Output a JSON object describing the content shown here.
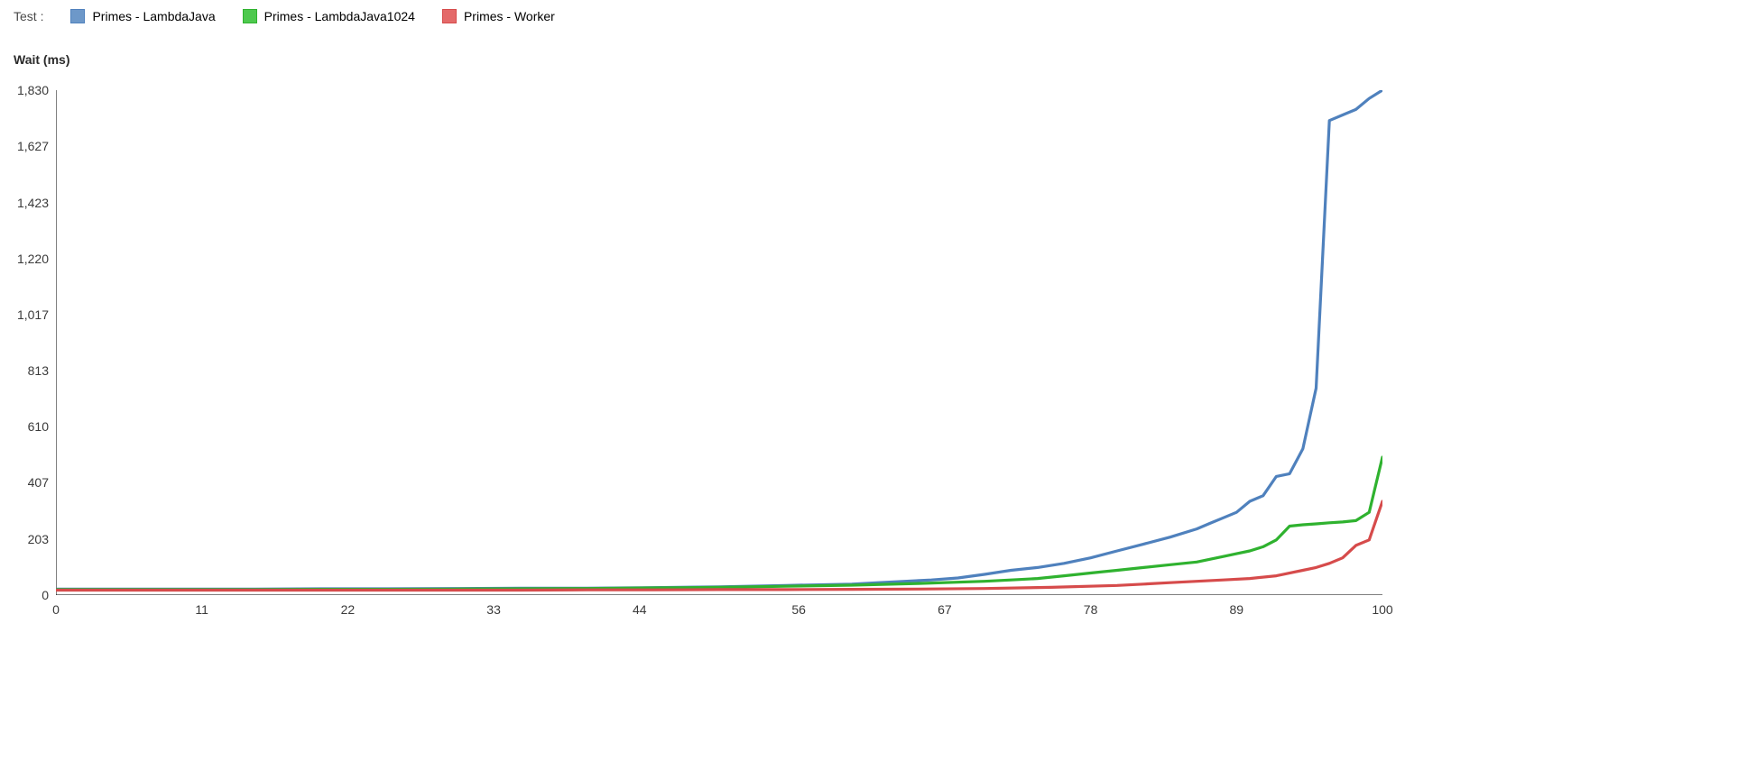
{
  "legend": {
    "label": "Test :",
    "items": [
      {
        "name": "Primes - LambdaJava",
        "color": "#4f81bd",
        "fill": "#6d98c9"
      },
      {
        "name": "Primes - LambdaJava1024",
        "color": "#2fb22f",
        "fill": "#4ec94e"
      },
      {
        "name": "Primes - Worker",
        "color": "#d64b4b",
        "fill": "#e46a6a"
      }
    ]
  },
  "y_title": "Wait (ms)",
  "chart_data": {
    "type": "line",
    "xlabel": "",
    "ylabel": "Wait (ms)",
    "xlim": [
      0,
      100
    ],
    "ylim": [
      0,
      1830
    ],
    "x_ticks": [
      0,
      11,
      22,
      33,
      44,
      56,
      67,
      78,
      89,
      100
    ],
    "y_ticks": [
      0,
      203,
      407,
      610,
      813,
      1017,
      1220,
      1423,
      1627,
      1830
    ],
    "series": [
      {
        "name": "Primes - LambdaJava",
        "color": "#4f81bd",
        "x": [
          0,
          5,
          10,
          15,
          20,
          25,
          30,
          35,
          40,
          45,
          50,
          55,
          60,
          62,
          64,
          66,
          68,
          70,
          72,
          74,
          76,
          78,
          80,
          82,
          84,
          86,
          87,
          88,
          89,
          90,
          91,
          92,
          93,
          94,
          95,
          96,
          97,
          98,
          99,
          100
        ],
        "values": [
          22,
          22,
          22,
          22,
          23,
          23,
          24,
          25,
          25,
          27,
          30,
          35,
          40,
          45,
          50,
          55,
          62,
          75,
          90,
          100,
          115,
          135,
          160,
          185,
          210,
          240,
          260,
          280,
          300,
          340,
          360,
          430,
          440,
          530,
          750,
          1720,
          1740,
          1760,
          1800,
          1830
        ]
      },
      {
        "name": "Primes - LambdaJava1024",
        "color": "#2fb22f",
        "x": [
          0,
          5,
          10,
          15,
          20,
          25,
          30,
          35,
          40,
          45,
          50,
          55,
          60,
          65,
          70,
          72,
          74,
          76,
          78,
          80,
          82,
          84,
          86,
          88,
          89,
          90,
          91,
          92,
          93,
          94,
          95,
          96,
          97,
          98,
          99,
          100
        ],
        "values": [
          20,
          20,
          20,
          20,
          21,
          21,
          22,
          23,
          24,
          26,
          28,
          32,
          36,
          42,
          50,
          55,
          60,
          70,
          80,
          90,
          100,
          110,
          120,
          140,
          150,
          160,
          175,
          200,
          250,
          255,
          258,
          262,
          265,
          270,
          300,
          500
        ]
      },
      {
        "name": "Primes - Worker",
        "color": "#d64b4b",
        "x": [
          0,
          5,
          10,
          15,
          20,
          25,
          30,
          35,
          40,
          45,
          50,
          55,
          60,
          65,
          70,
          75,
          80,
          82,
          84,
          86,
          88,
          90,
          92,
          94,
          95,
          96,
          97,
          98,
          99,
          100
        ],
        "values": [
          18,
          18,
          18,
          18,
          18,
          18,
          18,
          18,
          19,
          19,
          20,
          20,
          21,
          22,
          24,
          28,
          35,
          40,
          45,
          50,
          55,
          60,
          70,
          90,
          100,
          115,
          135,
          180,
          200,
          340
        ]
      }
    ]
  }
}
